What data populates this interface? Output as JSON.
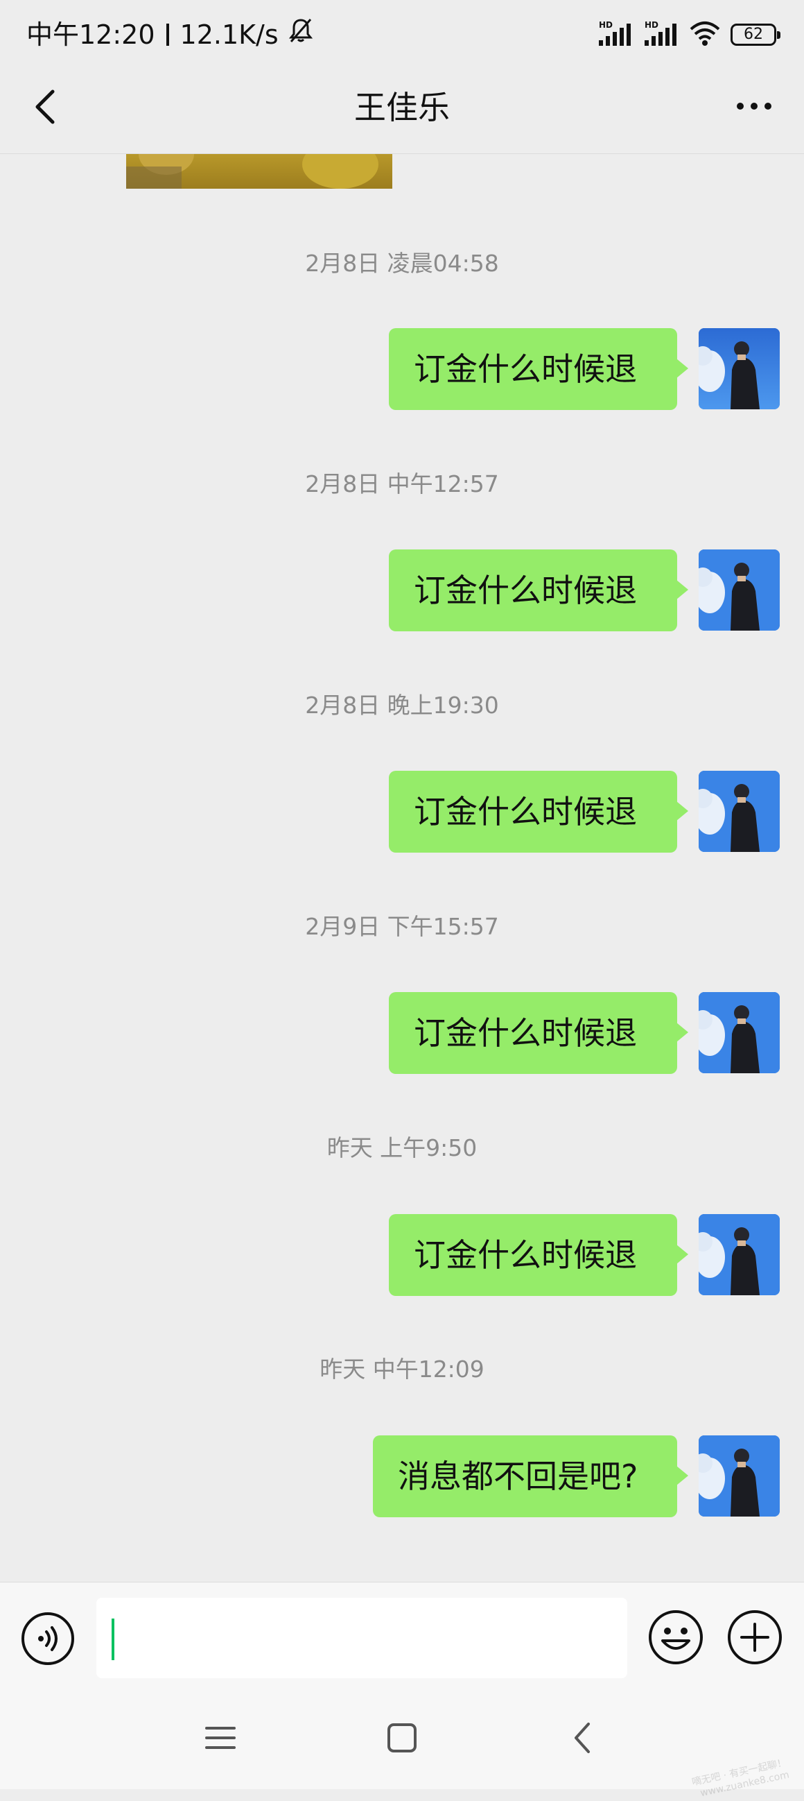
{
  "status_bar": {
    "time": "中午12:20",
    "speed": "12.1K/s",
    "battery": "62",
    "icons": [
      "mute-bell-icon",
      "hd-signal-icon",
      "hd-signal-icon",
      "wifi-icon",
      "battery-icon"
    ]
  },
  "header": {
    "title": "王佳乐",
    "back_icon": "back-chevron-icon",
    "more_icon": "more-dots-icon"
  },
  "messages": [
    {
      "timestamp": "2月8日 凌晨04:58",
      "text": "订金什么时候退"
    },
    {
      "timestamp": "2月8日 中午12:57",
      "text": "订金什么时候退"
    },
    {
      "timestamp": "2月8日 晚上19:30",
      "text": "订金什么时候退"
    },
    {
      "timestamp": "2月9日 下午15:57",
      "text": "订金什么时候退"
    },
    {
      "timestamp": "昨天 上午9:50",
      "text": "订金什么时候退"
    },
    {
      "timestamp": "昨天 中午12:09",
      "text": "消息都不回是吧?"
    }
  ],
  "input_bar": {
    "value": "",
    "icons": [
      "voice-icon",
      "emoji-icon",
      "plus-icon"
    ]
  },
  "system_nav": {
    "icons": [
      "menu-icon",
      "home-square-icon",
      "back-icon"
    ]
  },
  "watermark": {
    "line1": "嘀无吧 · 有买一起聊！",
    "line2": "www.zuanke8.com"
  },
  "colors": {
    "background": "#ededed",
    "bubble": "#95ec69",
    "accent": "#07c160",
    "timestamp": "#8a8a8a"
  }
}
